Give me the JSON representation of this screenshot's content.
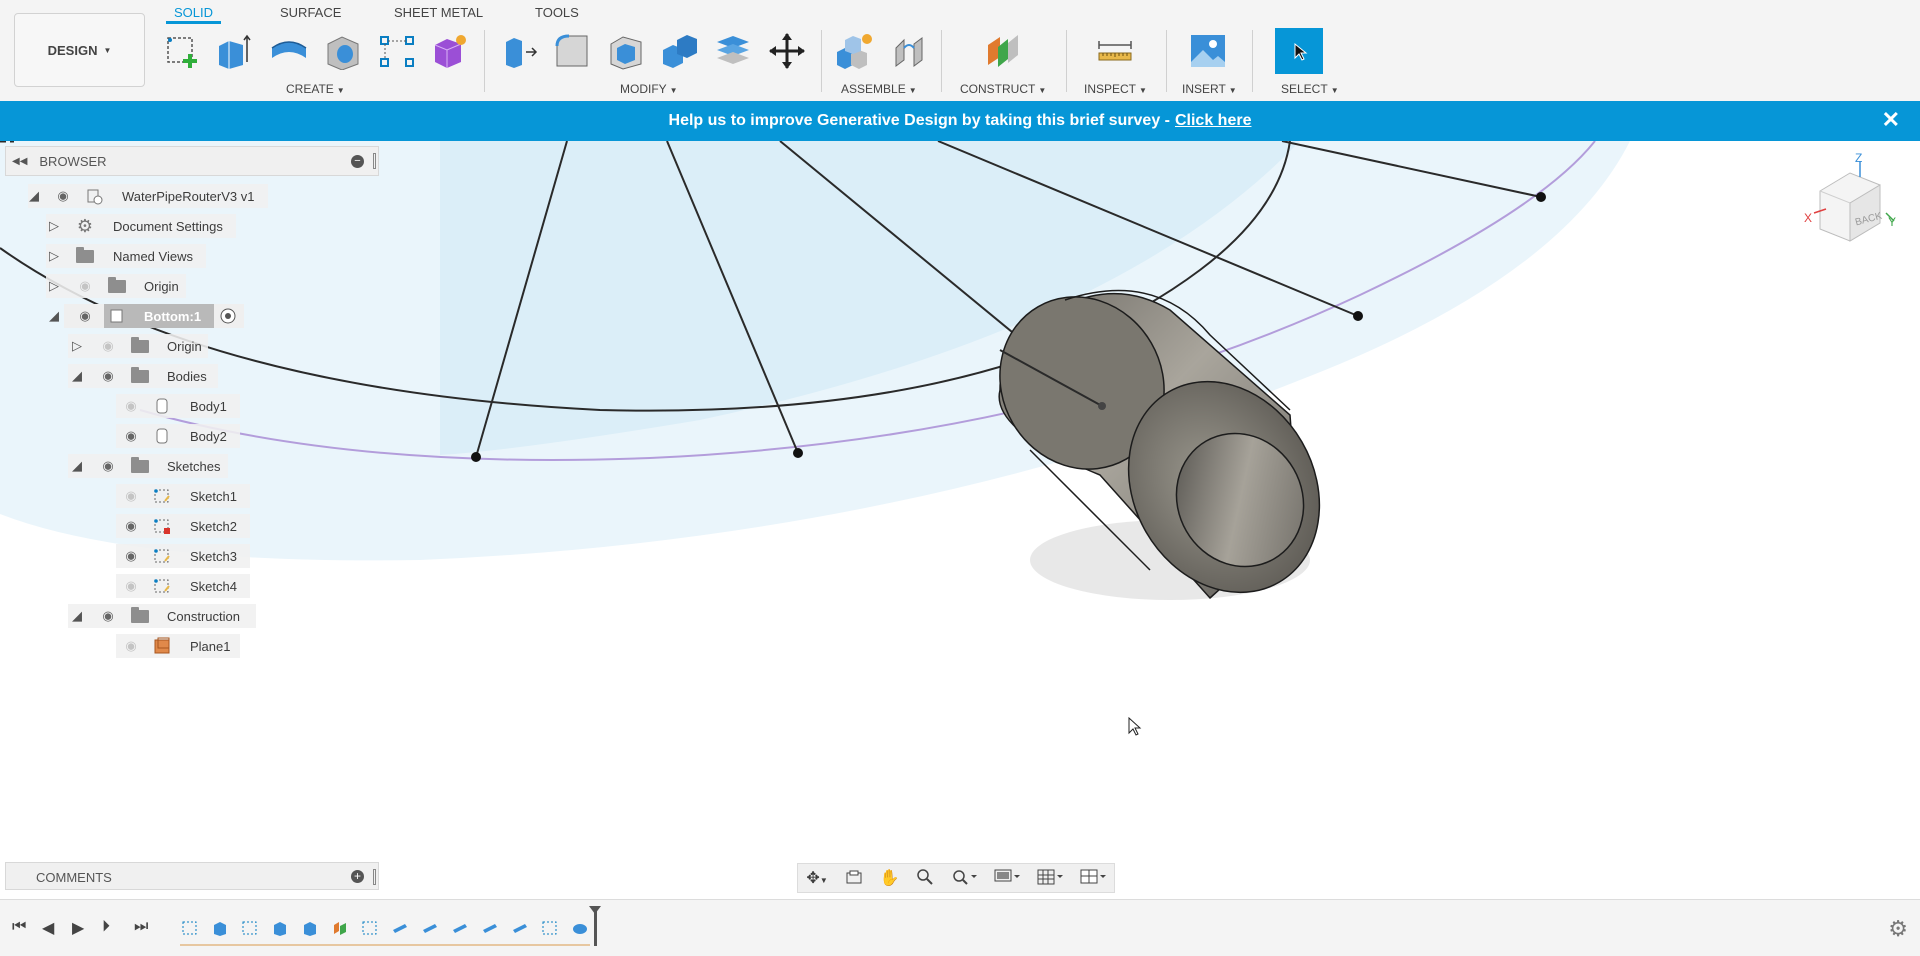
{
  "workspace": {
    "label": "DESIGN"
  },
  "tabs": [
    {
      "label": "SOLID",
      "active": true
    },
    {
      "label": "SURFACE",
      "active": false
    },
    {
      "label": "SHEET METAL",
      "active": false
    },
    {
      "label": "TOOLS",
      "active": false
    }
  ],
  "groups": {
    "create": "CREATE",
    "modify": "MODIFY",
    "assemble": "ASSEMBLE",
    "construct": "CONSTRUCT",
    "inspect": "INSPECT",
    "insert": "INSERT",
    "select": "SELECT"
  },
  "banner": {
    "text": "Help us to improve Generative Design by taking this brief survey -",
    "link": "Click here",
    "close_icon": "close-icon"
  },
  "browser": {
    "title": "BROWSER",
    "items": [
      {
        "label": "WaterPipeRouterV3 v1"
      },
      {
        "label": "Document Settings"
      },
      {
        "label": "Named Views"
      },
      {
        "label": "Origin"
      },
      {
        "label": "Bottom:1"
      },
      {
        "label": "Origin"
      },
      {
        "label": "Bodies"
      },
      {
        "label": "Body1"
      },
      {
        "label": "Body2"
      },
      {
        "label": "Sketches"
      },
      {
        "label": "Sketch1"
      },
      {
        "label": "Sketch2"
      },
      {
        "label": "Sketch3"
      },
      {
        "label": "Sketch4"
      },
      {
        "label": "Construction"
      },
      {
        "label": "Plane1"
      }
    ]
  },
  "comments": {
    "title": "COMMENTS"
  },
  "viewcube": {
    "face": "BACK",
    "axis_x": "X",
    "axis_y": "Y",
    "axis_z": "Z"
  },
  "colors": {
    "accent": "#0696d7",
    "toolbar": "#f4f4f4",
    "sketch_line": "#2a2a2a",
    "path": "#b39ddb",
    "plane": "#dbeef8"
  }
}
